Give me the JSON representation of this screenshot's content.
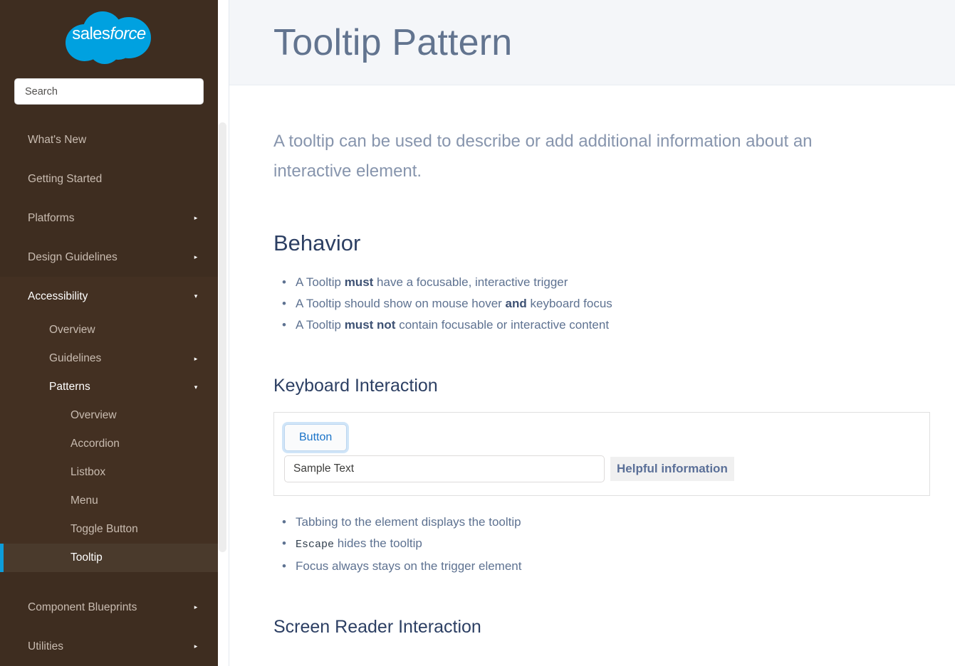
{
  "sidebar": {
    "logo_text_plain": "sales",
    "logo_text_italic": "force",
    "search": {
      "placeholder": "Search",
      "value": ""
    },
    "nav": [
      {
        "label": "What's New",
        "level": 1,
        "state": "none",
        "arrow": ""
      },
      {
        "label": "Getting Started",
        "level": 1,
        "state": "none",
        "arrow": ""
      },
      {
        "label": "Platforms",
        "level": 1,
        "state": "collapsed",
        "arrow": "▸"
      },
      {
        "label": "Design Guidelines",
        "level": 1,
        "state": "collapsed",
        "arrow": "▸"
      },
      {
        "label": "Accessibility",
        "level": 1,
        "state": "expanded",
        "arrow": "▾"
      },
      {
        "label": "Overview",
        "level": 2,
        "state": "none",
        "arrow": ""
      },
      {
        "label": "Guidelines",
        "level": 2,
        "state": "collapsed",
        "arrow": "▸"
      },
      {
        "label": "Patterns",
        "level": 2,
        "state": "expanded",
        "arrow": "▾"
      },
      {
        "label": "Overview",
        "level": 3,
        "state": "none",
        "arrow": ""
      },
      {
        "label": "Accordion",
        "level": 3,
        "state": "none",
        "arrow": ""
      },
      {
        "label": "Listbox",
        "level": 3,
        "state": "none",
        "arrow": ""
      },
      {
        "label": "Menu",
        "level": 3,
        "state": "none",
        "arrow": ""
      },
      {
        "label": "Toggle Button",
        "level": 3,
        "state": "none",
        "arrow": ""
      },
      {
        "label": "Tooltip",
        "level": 3,
        "state": "selected",
        "arrow": ""
      },
      {
        "label": "Component Blueprints",
        "level": 1,
        "state": "collapsed",
        "arrow": "▸"
      },
      {
        "label": "Utilities",
        "level": 1,
        "state": "collapsed",
        "arrow": "▸"
      }
    ]
  },
  "header": {
    "title": "Tooltip Pattern"
  },
  "main": {
    "intro": "A tooltip can be used to describe or add additional information about an interactive element.",
    "behavior": {
      "heading": "Behavior",
      "bullets": [
        {
          "pre": "A Tooltip ",
          "bold": "must",
          "post": " have a focusable, interactive trigger"
        },
        {
          "pre": "A Tooltip should show on mouse hover ",
          "bold": "and",
          "post": " keyboard focus"
        },
        {
          "pre": "A Tooltip ",
          "bold": "must not",
          "post": " contain focusable or interactive content"
        }
      ]
    },
    "keyboard": {
      "heading": "Keyboard Interaction",
      "demo": {
        "button_label": "Button",
        "input_value": "Sample Text",
        "input_placeholder": "",
        "tooltip_text": "Helpful information"
      },
      "bullets": [
        {
          "pre": "Tabbing to the element displays the tooltip",
          "code": "",
          "post": ""
        },
        {
          "pre": "",
          "code": "Escape",
          "post": " hides the tooltip"
        },
        {
          "pre": "Focus always stays on the trigger element",
          "code": "",
          "post": ""
        }
      ]
    },
    "screen_reader": {
      "heading": "Screen Reader Interaction"
    }
  },
  "colors": {
    "sidebar_bg": "#3e2d20",
    "sidebar_expanded_bg": "#433022",
    "sidebar_selected_bg": "#4a3a2c",
    "accent_blue": "#0d9dda",
    "logo_blue": "#00a1e0",
    "header_bg": "#f4f6f9",
    "heading_navy": "#2c3f63",
    "body_blue_gray": "#5e7291",
    "title_gray_blue": "#62748f",
    "button_blue": "#1a73c8",
    "tooltip_bg": "#f0f0f0"
  }
}
